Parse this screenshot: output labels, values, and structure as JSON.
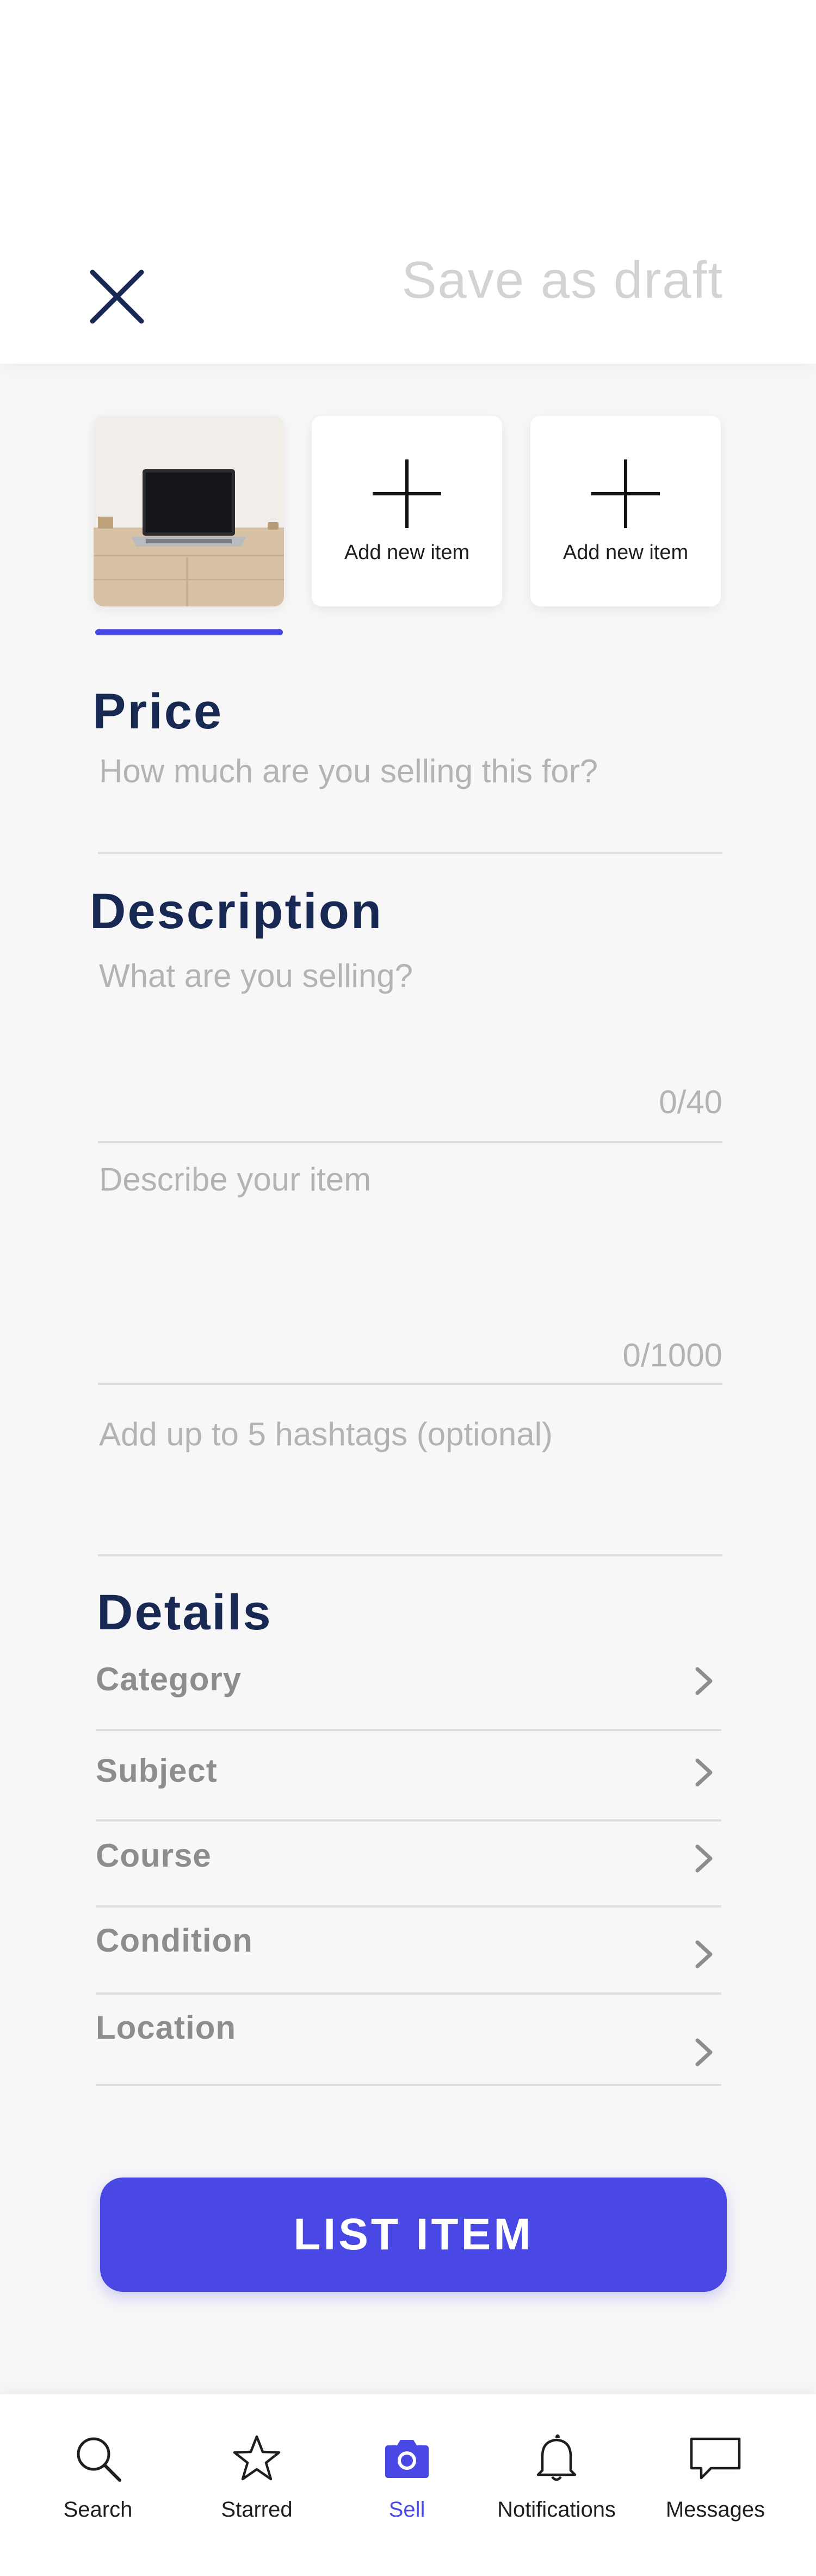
{
  "header": {
    "save_draft_label": "Save as draft"
  },
  "photos": {
    "add_label_1": "Add new item",
    "add_label_2": "Add new item"
  },
  "price": {
    "title": "Price",
    "placeholder": "How much are you selling this for?"
  },
  "description": {
    "title": "Description",
    "what_placeholder": "What are you selling?",
    "what_counter": "0/40",
    "describe_placeholder": "Describe your item",
    "describe_counter": "0/1000",
    "hashtags_placeholder": "Add up to 5 hashtags (optional)"
  },
  "details": {
    "title": "Details",
    "items": [
      {
        "label": "Category"
      },
      {
        "label": "Subject"
      },
      {
        "label": "Course"
      },
      {
        "label": "Condition"
      },
      {
        "label": "Location"
      }
    ]
  },
  "actions": {
    "list_item_label": "LIST ITEM"
  },
  "nav": {
    "items": [
      {
        "label": "Search",
        "icon": "search-icon"
      },
      {
        "label": "Starred",
        "icon": "star-icon"
      },
      {
        "label": "Sell",
        "icon": "camera-icon",
        "active": true
      },
      {
        "label": "Notifications",
        "icon": "bell-icon"
      },
      {
        "label": "Messages",
        "icon": "message-icon"
      }
    ]
  },
  "colors": {
    "accent": "#4a48e4",
    "heading": "#172953",
    "placeholder": "#b3b3b6",
    "muted_label": "#8d8d90"
  }
}
